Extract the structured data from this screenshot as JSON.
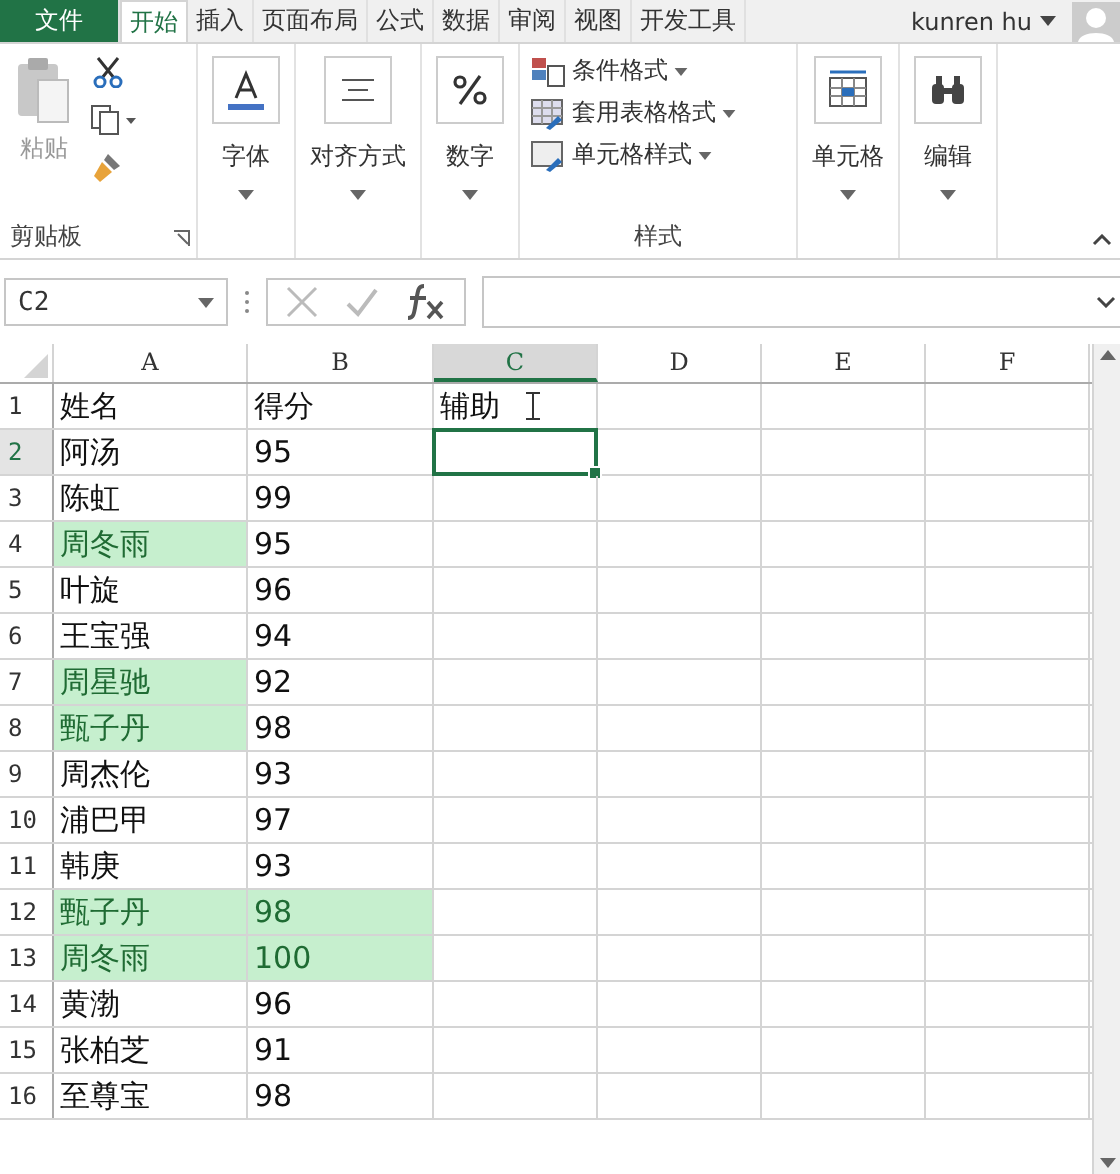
{
  "tabs": [
    {
      "label": "文件",
      "kind": "file"
    },
    {
      "label": "开始",
      "kind": "tab",
      "selected": true
    },
    {
      "label": "插入",
      "kind": "tab",
      "selected": false
    },
    {
      "label": "页面布局",
      "kind": "tab",
      "selected": false
    },
    {
      "label": "公式",
      "kind": "tab",
      "selected": false
    },
    {
      "label": "数据",
      "kind": "tab",
      "selected": false
    },
    {
      "label": "审阅",
      "kind": "tab",
      "selected": false
    },
    {
      "label": "视图",
      "kind": "tab",
      "selected": false
    },
    {
      "label": "开发工具",
      "kind": "tab",
      "selected": false
    }
  ],
  "user": {
    "name": "kunren hu"
  },
  "ribbon": {
    "clipboard": {
      "paste": "粘贴",
      "label": "剪贴板"
    },
    "big_buttons": [
      {
        "label": "字体",
        "kind": "font"
      },
      {
        "label": "对齐方式",
        "kind": "align"
      },
      {
        "label": "数字",
        "kind": "number"
      }
    ],
    "styles": {
      "items": [
        {
          "label": "条件格式",
          "kind": "conditional"
        },
        {
          "label": "套用表格格式",
          "kind": "table"
        },
        {
          "label": "单元格样式",
          "kind": "cellstyle"
        }
      ],
      "label": "样式"
    },
    "big_buttons_2": [
      {
        "label": "单元格",
        "kind": "cells"
      },
      {
        "label": "编辑",
        "kind": "edit"
      }
    ]
  },
  "formula_bar": {
    "name_box": "C2"
  },
  "columns": [
    {
      "label": "A",
      "selected": false
    },
    {
      "label": "B",
      "selected": false
    },
    {
      "label": "C",
      "selected": true
    },
    {
      "label": "D",
      "selected": false
    },
    {
      "label": "E",
      "selected": false
    },
    {
      "label": "F",
      "selected": false
    }
  ],
  "rows": [
    {
      "number": "1",
      "selected": false,
      "cells": [
        {
          "text": "姓名",
          "highlighted": false
        },
        {
          "text": "得分",
          "highlighted": false
        },
        {
          "text": "辅助",
          "highlighted": false
        }
      ]
    },
    {
      "number": "2",
      "selected": true,
      "cells": [
        {
          "text": "阿汤",
          "highlighted": false
        },
        {
          "text": "95",
          "highlighted": false
        }
      ]
    },
    {
      "number": "3",
      "selected": false,
      "cells": [
        {
          "text": "陈虹",
          "highlighted": false
        },
        {
          "text": "99",
          "highlighted": false
        }
      ]
    },
    {
      "number": "4",
      "selected": false,
      "cells": [
        {
          "text": "周冬雨",
          "highlighted": true
        },
        {
          "text": "95",
          "highlighted": false
        }
      ]
    },
    {
      "number": "5",
      "selected": false,
      "cells": [
        {
          "text": "叶旋",
          "highlighted": false
        },
        {
          "text": "96",
          "highlighted": false
        }
      ]
    },
    {
      "number": "6",
      "selected": false,
      "cells": [
        {
          "text": "王宝强",
          "highlighted": false
        },
        {
          "text": "94",
          "highlighted": false
        }
      ]
    },
    {
      "number": "7",
      "selected": false,
      "cells": [
        {
          "text": "周星驰",
          "highlighted": true
        },
        {
          "text": "92",
          "highlighted": false
        }
      ]
    },
    {
      "number": "8",
      "selected": false,
      "cells": [
        {
          "text": "甄子丹",
          "highlighted": true
        },
        {
          "text": "98",
          "highlighted": false
        }
      ]
    },
    {
      "number": "9",
      "selected": false,
      "cells": [
        {
          "text": "周杰伦",
          "highlighted": false
        },
        {
          "text": "93",
          "highlighted": false
        }
      ]
    },
    {
      "number": "10",
      "selected": false,
      "cells": [
        {
          "text": "浦巴甲",
          "highlighted": false
        },
        {
          "text": "97",
          "highlighted": false
        }
      ]
    },
    {
      "number": "11",
      "selected": false,
      "cells": [
        {
          "text": "韩庚",
          "highlighted": false
        },
        {
          "text": "93",
          "highlighted": false
        }
      ]
    },
    {
      "number": "12",
      "selected": false,
      "cells": [
        {
          "text": "甄子丹",
          "highlighted": true
        },
        {
          "text": "98",
          "highlighted": true
        }
      ]
    },
    {
      "number": "13",
      "selected": false,
      "cells": [
        {
          "text": "周冬雨",
          "highlighted": true
        },
        {
          "text": "100",
          "highlighted": true
        }
      ]
    },
    {
      "number": "14",
      "selected": false,
      "cells": [
        {
          "text": "黄渤",
          "highlighted": false
        },
        {
          "text": "96",
          "highlighted": false
        }
      ]
    },
    {
      "number": "15",
      "selected": false,
      "cells": [
        {
          "text": "张柏芝",
          "highlighted": false
        },
        {
          "text": "91",
          "highlighted": false
        }
      ]
    },
    {
      "number": "16",
      "selected": false,
      "cells": [
        {
          "text": "至尊宝",
          "highlighted": false
        },
        {
          "text": "98",
          "highlighted": false
        }
      ]
    }
  ]
}
